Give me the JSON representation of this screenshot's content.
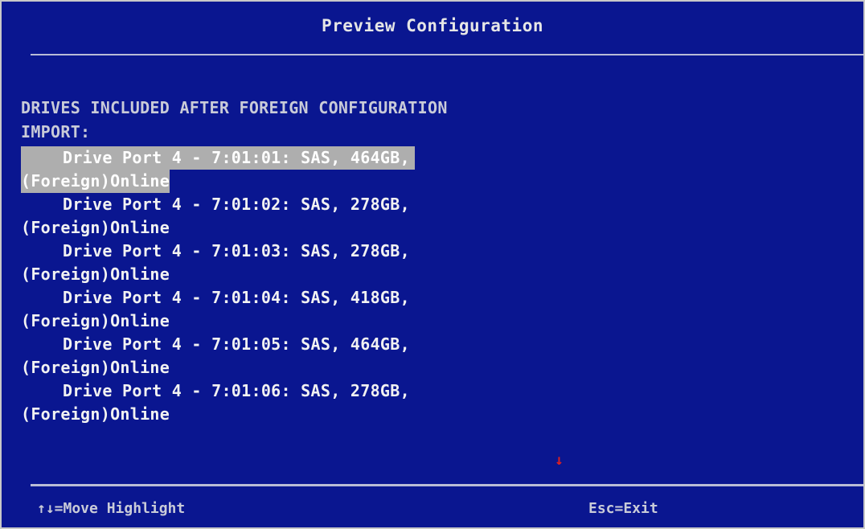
{
  "window": {
    "title": "Preview Configuration"
  },
  "section": {
    "heading_line1": "DRIVES INCLUDED AFTER FOREIGN CONFIGURATION",
    "heading_line2": "IMPORT:"
  },
  "drives": [
    {
      "line1": "Drive Port 4 - 7:01:01: SAS, 464GB,",
      "line2": "(Foreign)Online",
      "selected": true
    },
    {
      "line1": "Drive Port 4 - 7:01:02: SAS, 278GB,",
      "line2": "(Foreign)Online",
      "selected": false
    },
    {
      "line1": "Drive Port 4 - 7:01:03: SAS, 278GB,",
      "line2": "(Foreign)Online",
      "selected": false
    },
    {
      "line1": "Drive Port 4 - 7:01:04: SAS, 418GB,",
      "line2": "(Foreign)Online",
      "selected": false
    },
    {
      "line1": "Drive Port 4 - 7:01:05: SAS, 464GB,",
      "line2": "(Foreign)Online",
      "selected": false
    },
    {
      "line1": "Drive Port 4 - 7:01:06: SAS, 278GB,",
      "line2": "(Foreign)Online",
      "selected": false
    }
  ],
  "scroll_indicator": {
    "glyph": "↓",
    "color": "#e02020"
  },
  "footer": {
    "left": "↑↓=Move Highlight",
    "right": "Esc=Exit"
  },
  "colors": {
    "background": "#0a1690",
    "highlight": "#aeaeae",
    "text": "#f2f2f2"
  }
}
